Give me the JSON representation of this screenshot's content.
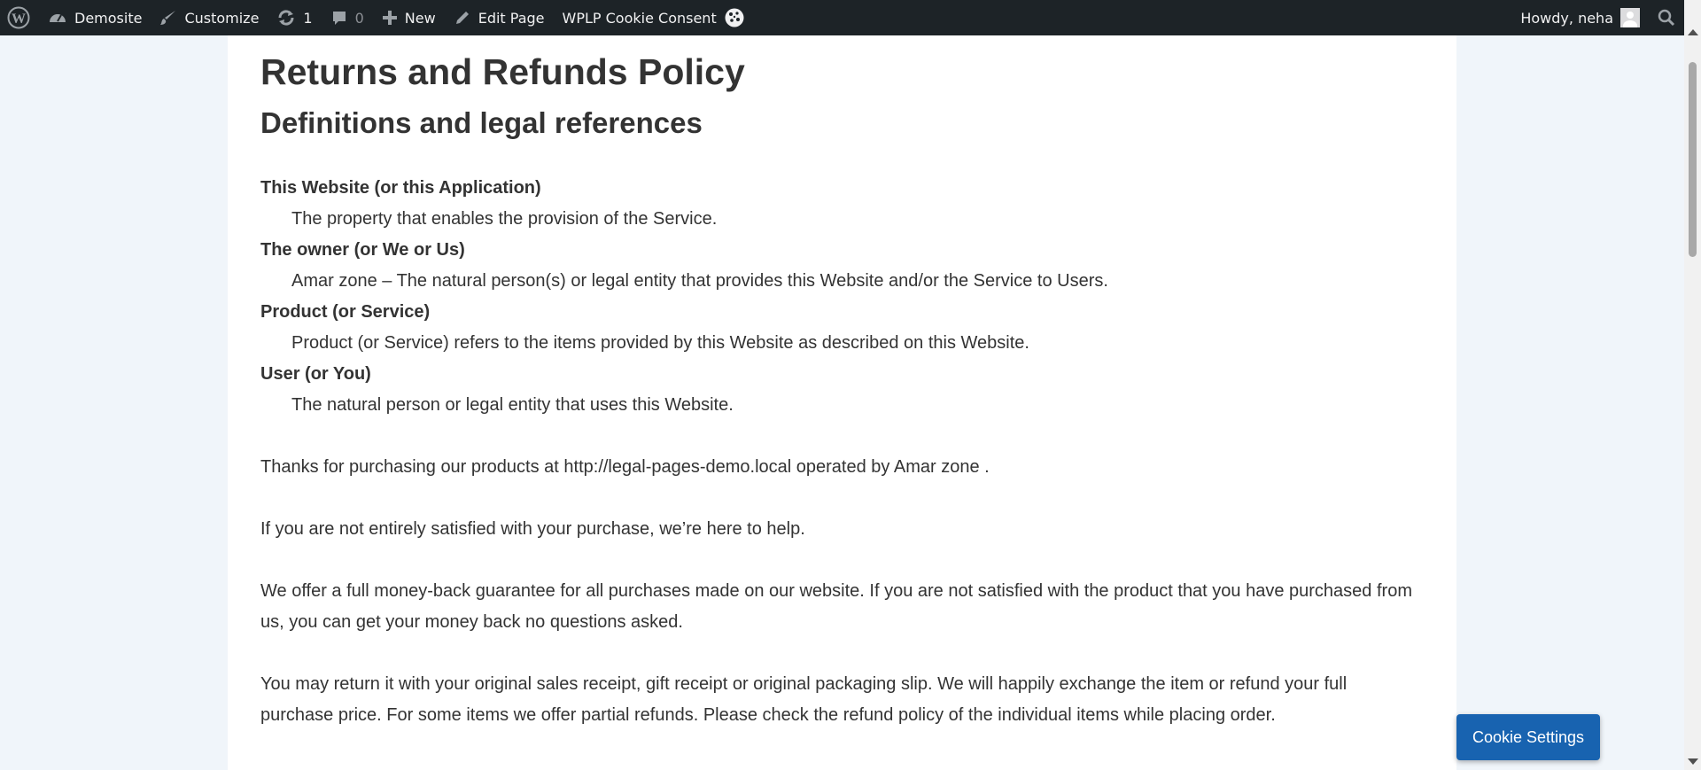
{
  "adminbar": {
    "site_name": "Demosite",
    "customize": "Customize",
    "updates_count": "1",
    "comments_count": "0",
    "new": "New",
    "edit_page": "Edit Page",
    "cookie_consent": "WPLP Cookie Consent",
    "howdy": "Howdy, neha"
  },
  "content": {
    "title": "Returns and Refunds Policy",
    "subtitle": "Definitions and legal references",
    "definitions": [
      {
        "term": "This Website (or this Application)",
        "desc": "The property that enables the provision of the Service."
      },
      {
        "term": "The owner (or We or Us)",
        "desc": "Amar zone – The natural person(s) or legal entity that provides this Website and/or the Service to Users."
      },
      {
        "term": "Product (or Service)",
        "desc": "Product (or Service) refers to the items provided by this Website as described on this Website."
      },
      {
        "term": "User (or You)",
        "desc": "The natural person or legal entity that uses this Website."
      }
    ],
    "paragraphs": [
      "Thanks for purchasing our products at http://legal-pages-demo.local operated by Amar zone .",
      "If you are not entirely satisfied with your purchase, we’re here to help.",
      "We offer a full money-back guarantee for all purchases made on our website. If you are not satisfied with the product that you have purchased from us, you can get your money back no questions asked.",
      "You may return it with your original sales receipt, gift receipt or original packaging slip. We will happily exchange the item or refund your full purchase price. For some items we offer partial refunds. Please check the refund policy of the individual items while placing order."
    ]
  },
  "cookie_button": "Cookie Settings",
  "colors": {
    "adminbar_bg": "#1d2327",
    "page_bg": "#f0f5fa",
    "cookie_button": "#1863b0"
  }
}
